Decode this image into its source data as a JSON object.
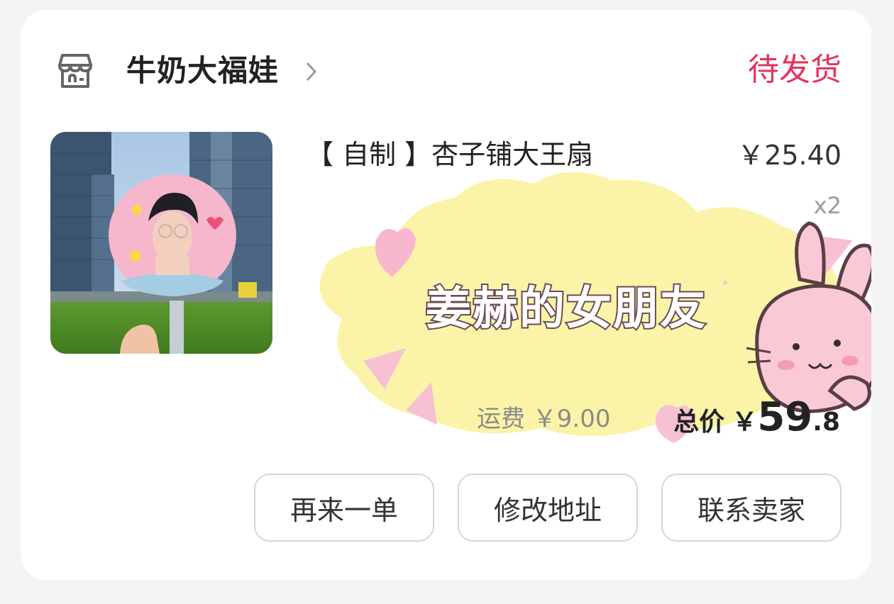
{
  "shop": {
    "name": "牛奶大福娃",
    "icon": "store-icon",
    "chevron_icon": "chevron-right-icon"
  },
  "order": {
    "status": "待发货"
  },
  "product": {
    "title": "【 自制 】杏子铺大王扇",
    "unit_price": "￥25.40",
    "quantity": "x2",
    "image": "product-photo-hand-fan"
  },
  "sticker": {
    "text": "姜赫的女朋友",
    "image": "bunny-sticker"
  },
  "summary": {
    "shipping": "运费 ￥9.00",
    "total_label": "总价",
    "total_currency": "￥",
    "total_int": "59",
    "total_dec": ".8"
  },
  "actions": {
    "reorder": "再来一单",
    "modify_address": "修改地址",
    "contact_seller": "联系卖家"
  },
  "colors": {
    "status": "#e3345d",
    "background": "#f4f4f4",
    "card": "#ffffff"
  }
}
